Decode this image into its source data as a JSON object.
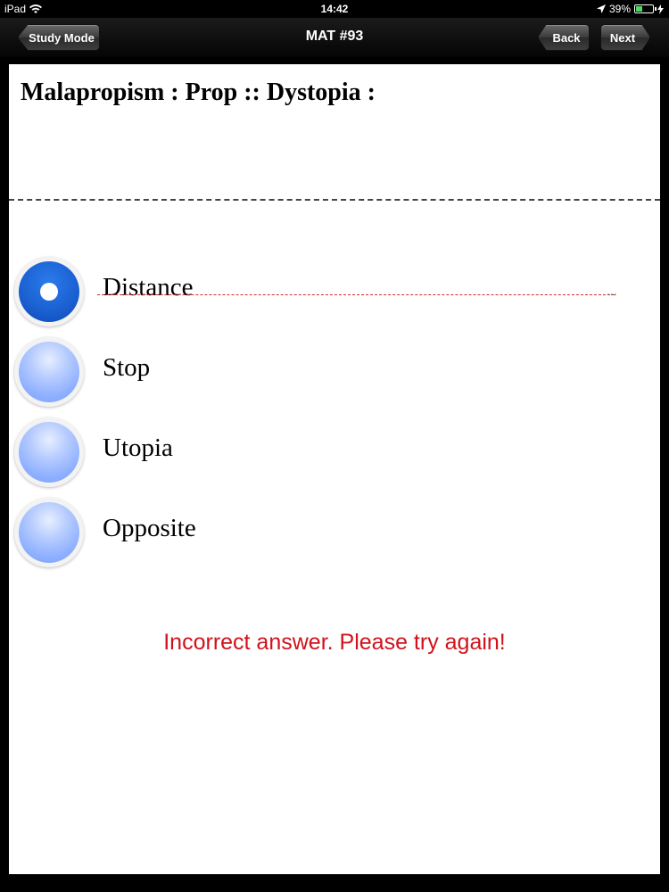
{
  "status_bar": {
    "carrier": "iPad",
    "time": "14:42",
    "battery_percent": "39%",
    "battery_level": 0.39,
    "icons": [
      "wifi-icon",
      "location-arrow-icon",
      "battery-icon",
      "charging-bolt-icon"
    ]
  },
  "nav": {
    "title": "MAT #93",
    "study_mode_label": "Study Mode",
    "back_label": "Back",
    "next_label": "Next"
  },
  "question": {
    "text": "Malapropism : Prop :: Dystopia :"
  },
  "options": [
    {
      "label": "Distance",
      "selected": true,
      "struck_out": true
    },
    {
      "label": "Stop",
      "selected": false,
      "struck_out": false
    },
    {
      "label": "Utopia",
      "selected": false,
      "struck_out": false
    },
    {
      "label": "Opposite",
      "selected": false,
      "struck_out": false
    }
  ],
  "feedback": {
    "text": "Incorrect answer. Please try again!",
    "color": "#d0121b"
  },
  "colors": {
    "radio_selected": "#1a5fd0",
    "radio_unselected": "#8fb0ff",
    "strike_line": "#d42a2a"
  }
}
